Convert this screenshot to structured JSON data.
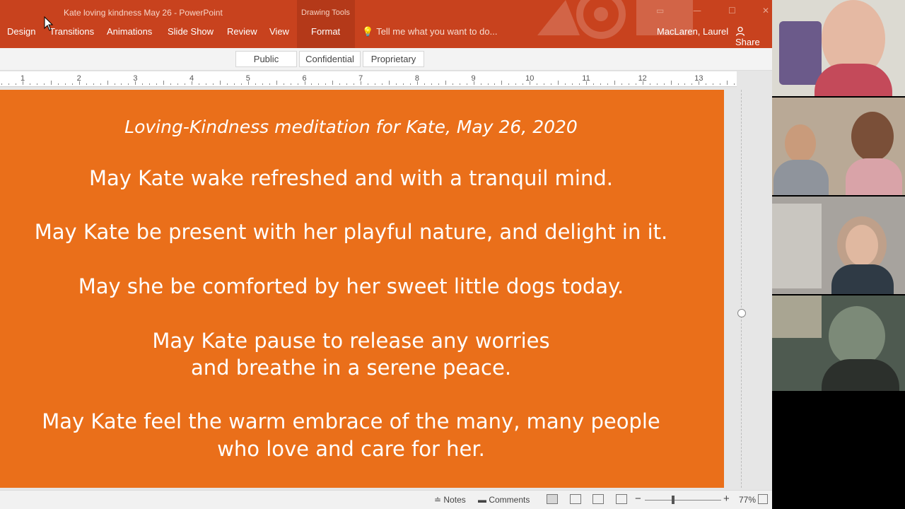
{
  "window": {
    "doc_title": "Kate loving kindness May 26 - PowerPoint",
    "context_label": "Drawing Tools",
    "user_name": "MacLaren, Laurel",
    "share_label": "Share"
  },
  "ribbon": {
    "tabs": [
      "Design",
      "Transitions",
      "Animations",
      "Slide Show",
      "Review",
      "View",
      "Format"
    ],
    "tell_me_placeholder": "Tell me what you want to do..."
  },
  "sensitivity": {
    "options": [
      "Public",
      "Confidential",
      "Proprietary"
    ]
  },
  "ruler": {
    "numbers": [
      "1",
      "2",
      "3",
      "4",
      "5",
      "6",
      "7",
      "8",
      "9",
      "10",
      "11",
      "12",
      "13"
    ]
  },
  "slide": {
    "title": "Loving-Kindness meditation for Kate, May 26, 2020",
    "lines": [
      "May Kate wake refreshed and with a tranquil mind.",
      "May Kate be present with her playful nature, and delight in it.",
      "May she be comforted by her sweet little dogs today.",
      "May Kate pause to release any worries",
      "and breathe in a serene peace.",
      "May Kate feel the warm embrace of the many, many people",
      "who love and care for her."
    ]
  },
  "statusbar": {
    "notes_label": "Notes",
    "comments_label": "Comments",
    "zoom_out": "−",
    "zoom_in": "+",
    "zoom_level": "77%",
    "zoom_fraction": 0.77
  },
  "colors": {
    "title_bar": "#c8421e",
    "slide_bg": "#ea6f1a",
    "slide_text": "#ffffff"
  },
  "video_tiles": [
    "participant-1",
    "participant-2",
    "participant-3",
    "participant-4"
  ]
}
